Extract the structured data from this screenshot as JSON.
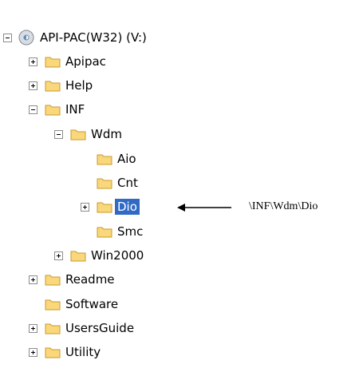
{
  "root": {
    "label": "API-PAC(W32) (V:)",
    "icon": "cd-drive-icon",
    "expanded": true
  },
  "nodes": {
    "apipac": {
      "label": "Apipac",
      "toggle": "+"
    },
    "help": {
      "label": "Help",
      "toggle": "+"
    },
    "inf": {
      "label": "INF",
      "toggle": "-"
    },
    "wdm": {
      "label": "Wdm",
      "toggle": "-"
    },
    "aio": {
      "label": "Aio"
    },
    "cnt": {
      "label": "Cnt"
    },
    "dio": {
      "label": "Dio",
      "toggle": "+",
      "selected": true
    },
    "smc": {
      "label": "Smc"
    },
    "win2000": {
      "label": "Win2000",
      "toggle": "+"
    },
    "readme": {
      "label": "Readme",
      "toggle": "+"
    },
    "software": {
      "label": "Software"
    },
    "usersguide": {
      "label": "UsersGuide",
      "toggle": "+"
    },
    "utility": {
      "label": "Utility",
      "toggle": "+"
    }
  },
  "annotation": {
    "text": "\\INF\\Wdm\\Dio"
  },
  "colors": {
    "selection": "#316ac5",
    "folder_fill": "#f9d77a",
    "folder_stroke": "#c99b2c"
  }
}
